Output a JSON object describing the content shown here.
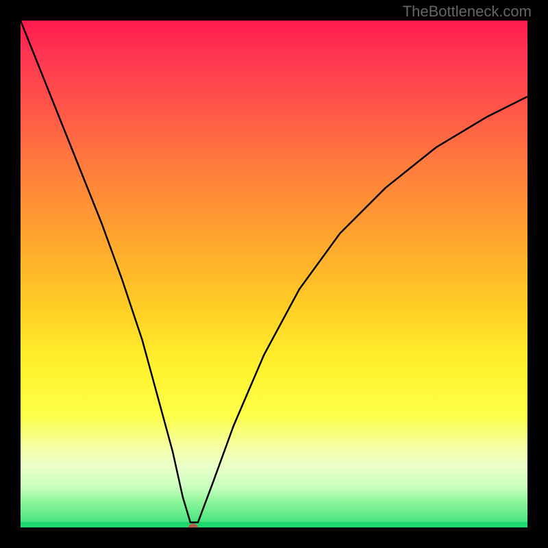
{
  "watermark": "TheBottleneck.com",
  "chart_data": {
    "type": "line",
    "title": "",
    "xlabel": "",
    "ylabel": "",
    "xlim": [
      0,
      100
    ],
    "ylim": [
      0,
      100
    ],
    "gradient_meaning": "bottleneck severity (red=high, green=none)",
    "minimum_point": {
      "x": 34,
      "y": 0
    },
    "series": [
      {
        "name": "bottleneck-curve",
        "x": [
          0,
          4,
          8,
          12,
          16,
          20,
          24,
          27,
          30,
          32,
          33.5,
          35,
          38,
          42,
          48,
          55,
          63,
          72,
          82,
          92,
          100
        ],
        "values": [
          100,
          90,
          80,
          70,
          60,
          49,
          37,
          26,
          15,
          6,
          1,
          1,
          9,
          20,
          34,
          47,
          58,
          67,
          75,
          81,
          85
        ]
      }
    ],
    "marker": {
      "x": 34,
      "y": 0,
      "color": "#b85b4c"
    },
    "colors": {
      "curve": "#000000",
      "background_top": "#ff1a4d",
      "background_bottom": "#1ed96e",
      "frame": "#000000"
    }
  }
}
